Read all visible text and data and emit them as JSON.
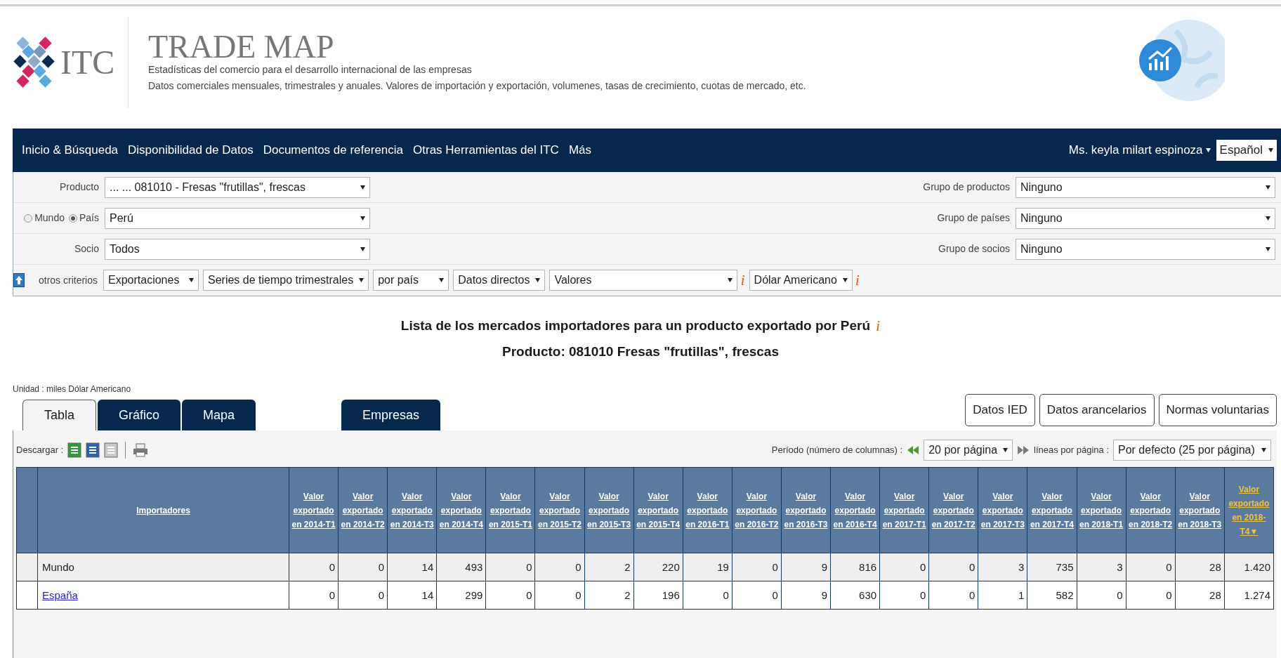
{
  "header": {
    "logo_text": "ITC",
    "title": "TRADE MAP",
    "subtitle_1": "Estadísticas del comercio para el desarrollo internacional de las empresas",
    "subtitle_2": "Datos comerciales mensuales, trimestrales y anuales. Valores de importación y exportación, volumenes, tasas de crecimiento, cuotas de mercado, etc."
  },
  "nav": {
    "items": [
      "Inicio & Búsqueda",
      "Disponibilidad de Datos",
      "Documentos de referencia",
      "Otras Herramientas del ITC",
      "Más"
    ],
    "user": "Ms. keyla milart espinoza",
    "language": "Español"
  },
  "filters": [
    {
      "kind": "label",
      "label": "Producto",
      "value": "... ... 081010 - Fresas \"frutillas\", frescas",
      "group_label": "Grupo de productos",
      "group_value": "Ninguno"
    },
    {
      "kind": "radio",
      "options": [
        {
          "label": "Mundo",
          "selected": false
        },
        {
          "label": "País",
          "selected": true
        }
      ],
      "value": "Perú",
      "group_label": "Grupo de países",
      "group_value": "Ninguno"
    },
    {
      "kind": "label",
      "label": "Socio",
      "value": "Todos",
      "group_label": "Grupo de socios",
      "group_value": "Ninguno"
    }
  ],
  "criteria": {
    "label": "otros criterios",
    "selects": [
      {
        "value": "Exportaciones"
      },
      {
        "value": "Series de tiempo trimestrales"
      },
      {
        "value": "por país"
      },
      {
        "value": "Datos directos"
      },
      {
        "value": "Valores",
        "info": "i"
      },
      {
        "value": "Dólar Americano",
        "info": "i"
      }
    ]
  },
  "title": {
    "text": "Lista de los mercados importadores para un producto exportado por Perú",
    "info": "i",
    "subtitle": "Producto: 081010 Fresas \"frutillas\", frescas"
  },
  "unit": "Unidad : miles Dólar Americano",
  "tabs": [
    {
      "label": "Tabla",
      "selected": true
    },
    {
      "label": "Gráfico",
      "selected": false
    },
    {
      "label": "Mapa",
      "selected": false
    }
  ],
  "extra_tabs": [
    {
      "label": "Empresas",
      "selected": false
    }
  ],
  "buttons": [
    "Datos IED",
    "Datos arancelarios",
    "Normas voluntarias"
  ],
  "toolbar": {
    "download_label": "Descargar :",
    "period_label": "Período (número de columnas) :",
    "period_value": "20 por página",
    "lines_label": "líneas por página :",
    "lines_value": "Por defecto (25 por página)"
  },
  "table": {
    "columns": [
      {
        "label": "Importadores",
        "sorted": false
      },
      {
        "label": "Valor exportado en 2014-T1",
        "sorted": false
      },
      {
        "label": "Valor exportado en 2014-T2",
        "sorted": false
      },
      {
        "label": "Valor exportado en 2014-T3",
        "sorted": false
      },
      {
        "label": "Valor exportado en 2014-T4",
        "sorted": false
      },
      {
        "label": "Valor exportado en 2015-T1",
        "sorted": false
      },
      {
        "label": "Valor exportado en 2015-T2",
        "sorted": false
      },
      {
        "label": "Valor exportado en 2015-T3",
        "sorted": false
      },
      {
        "label": "Valor exportado en 2015-T4",
        "sorted": false
      },
      {
        "label": "Valor exportado en 2016-T1",
        "sorted": false
      },
      {
        "label": "Valor exportado en 2016-T2",
        "sorted": false
      },
      {
        "label": "Valor exportado en 2016-T3",
        "sorted": false
      },
      {
        "label": "Valor exportado en 2016-T4",
        "sorted": false
      },
      {
        "label": "Valor exportado en 2017-T1",
        "sorted": false
      },
      {
        "label": "Valor exportado en 2017-T2",
        "sorted": false
      },
      {
        "label": "Valor exportado en 2017-T3",
        "sorted": false
      },
      {
        "label": "Valor exportado en 2017-T4",
        "sorted": false
      },
      {
        "label": "Valor exportado en 2018-T1",
        "sorted": false
      },
      {
        "label": "Valor exportado en 2018-T2",
        "sorted": false
      },
      {
        "label": "Valor exportado en 2018-T3",
        "sorted": false
      },
      {
        "label": "Valor exportado en 2018-T4",
        "sorted": true,
        "sort_mark": "▼"
      }
    ],
    "rows": [
      {
        "name": "Mundo",
        "link": false,
        "values": [
          "0",
          "0",
          "14",
          "493",
          "0",
          "0",
          "2",
          "220",
          "19",
          "0",
          "9",
          "816",
          "0",
          "0",
          "3",
          "735",
          "3",
          "0",
          "28",
          "1.420"
        ]
      },
      {
        "name": "España",
        "link": true,
        "values": [
          "0",
          "0",
          "14",
          "299",
          "0",
          "0",
          "2",
          "196",
          "0",
          "0",
          "9",
          "630",
          "0",
          "0",
          "1",
          "582",
          "0",
          "0",
          "28",
          "1.274"
        ]
      }
    ]
  }
}
